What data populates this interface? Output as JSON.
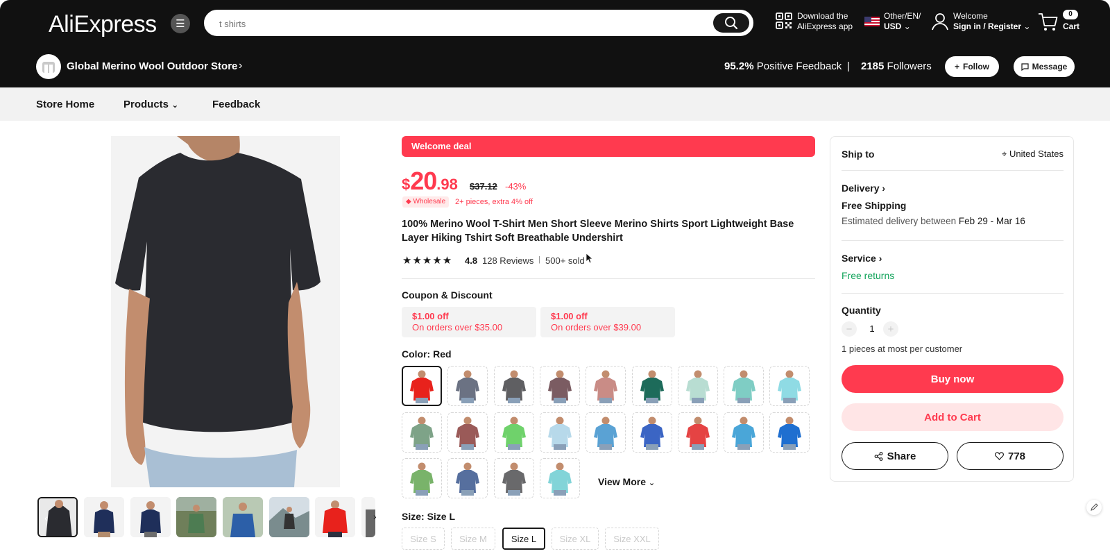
{
  "header": {
    "logo": "AliExpress",
    "search_placeholder": "t shirts",
    "app_line1": "Download the",
    "app_line2": "AliExpress app",
    "locale_line1": "Other/EN/",
    "locale_line2": "USD",
    "account_line1": "Welcome",
    "account_line2": "Sign in / Register",
    "cart_count": "0",
    "cart_label": "Cart"
  },
  "store": {
    "name": "Global Merino Wool Outdoor Store",
    "feedback_value": "95.2%",
    "feedback_label": "Positive Feedback",
    "separator": "|",
    "followers_value": "2185",
    "followers_label": "Followers",
    "follow_label": "Follow",
    "message_label": "Message"
  },
  "store_nav": {
    "home": "Store Home",
    "products": "Products",
    "feedback": "Feedback"
  },
  "product": {
    "deal_banner": "Welcome deal",
    "currency": "$",
    "price_int": "20",
    "price_dec": ".98",
    "old_price": "$37.12",
    "discount": "-43%",
    "wholesale_badge": "Wholesale",
    "wholesale_text": "2+ pieces, extra 4% off",
    "title": "100% Merino Wool T-Shirt Men Short Sleeve Merino Shirts Sport Lightweight Base Layer Hiking Tshirt Soft Breathable Undershirt",
    "stars": "★★★★★",
    "rating": "4.8",
    "reviews": "128 Reviews",
    "sold": "500+ sold",
    "coupon_heading": "Coupon & Discount",
    "coupons": [
      {
        "amount": "$1.00 off",
        "condition": "On orders over $35.00"
      },
      {
        "amount": "$1.00 off",
        "condition": "On orders over $39.00"
      }
    ],
    "color_heading": "Color: Red",
    "colors": [
      {
        "name": "red",
        "color": "#e8221c"
      },
      {
        "name": "slate",
        "color": "#6b7283"
      },
      {
        "name": "charcoal",
        "color": "#5f5f62"
      },
      {
        "name": "plum",
        "color": "#7b5c62"
      },
      {
        "name": "rose",
        "color": "#c98c86"
      },
      {
        "name": "teal",
        "color": "#1d6b5a"
      },
      {
        "name": "mint",
        "color": "#b8ddd2"
      },
      {
        "name": "aqua",
        "color": "#7fcdc4"
      },
      {
        "name": "sky",
        "color": "#8fdbe4"
      },
      {
        "name": "sage",
        "color": "#7ea388"
      },
      {
        "name": "rust",
        "color": "#9a5a58"
      },
      {
        "name": "lime",
        "color": "#6fd26b"
      },
      {
        "name": "light-blue",
        "color": "#b7d9ea"
      },
      {
        "name": "azure",
        "color": "#5aa2d4"
      },
      {
        "name": "royal",
        "color": "#3b65c4"
      },
      {
        "name": "crimson",
        "color": "#e54343"
      },
      {
        "name": "ocean",
        "color": "#4aa6d8"
      },
      {
        "name": "cobalt",
        "color": "#1f6fd0"
      },
      {
        "name": "leaf",
        "color": "#79b36a"
      },
      {
        "name": "denim",
        "color": "#566f9e"
      },
      {
        "name": "graphite",
        "color": "#69696b"
      },
      {
        "name": "turquoise",
        "color": "#82d4d8"
      }
    ],
    "view_more": "View More",
    "size_heading": "Size: Size L",
    "sizes": [
      "Size S",
      "Size M",
      "Size L",
      "Size XL",
      "Size XXL"
    ],
    "selected_size": "Size L"
  },
  "panel": {
    "ship_to": "Ship to",
    "country": "United States",
    "delivery": "Delivery",
    "free_shipping": "Free Shipping",
    "est_label": "Estimated delivery between",
    "est_dates": "Feb 29 - Mar 16",
    "service": "Service",
    "free_returns": "Free returns",
    "quantity": "Quantity",
    "qty_value": "1",
    "limit": "1 pieces at most per customer",
    "buy_now": "Buy now",
    "add_to_cart": "Add to Cart",
    "share": "Share",
    "wishlist_count": "778"
  },
  "colors": {
    "header_bg": "#111111",
    "accent": "#ff3a4f",
    "success": "#11a35a"
  }
}
